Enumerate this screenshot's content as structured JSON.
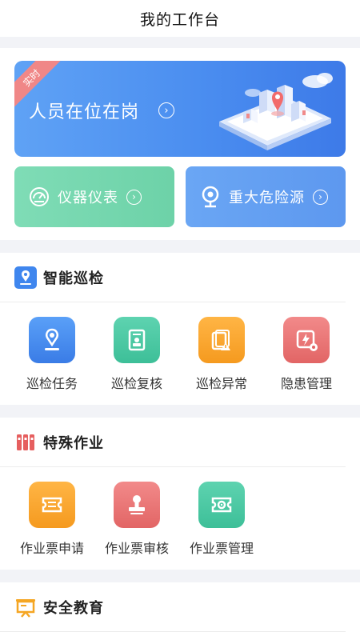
{
  "header": {
    "title": "我的工作台"
  },
  "banner": {
    "tag": "实时",
    "title": "人员在位在岗",
    "arrow_icon": "chevron-right-circle-icon"
  },
  "quick_cards": [
    {
      "label": "仪器仪表",
      "icon": "gauge-icon",
      "color": "#72d7ae"
    },
    {
      "label": "重大危险源",
      "icon": "location-pin-icon",
      "color": "#64a0f2"
    }
  ],
  "sections": [
    {
      "title": "智能巡检",
      "icon": "map-pin-icon",
      "items": [
        {
          "label": "巡检任务",
          "icon": "location-pin-icon",
          "color": "#4a8ef0"
        },
        {
          "label": "巡检复核",
          "icon": "badge-card-icon",
          "color": "#4cc9a3"
        },
        {
          "label": "巡检异常",
          "icon": "warning-document-icon",
          "color": "#f8a832"
        },
        {
          "label": "隐患管理",
          "icon": "lightning-gear-icon",
          "color": "#ea7474"
        }
      ]
    },
    {
      "title": "特殊作业",
      "icon": "tools-icon",
      "items": [
        {
          "label": "作业票申请",
          "icon": "ticket-icon",
          "color": "#f8a832"
        },
        {
          "label": "作业票审核",
          "icon": "stamp-icon",
          "color": "#ea7474"
        },
        {
          "label": "作业票管理",
          "icon": "ticket-gear-icon",
          "color": "#4cc9a3"
        }
      ]
    },
    {
      "title": "安全教育",
      "icon": "presentation-board-icon",
      "items": []
    }
  ]
}
